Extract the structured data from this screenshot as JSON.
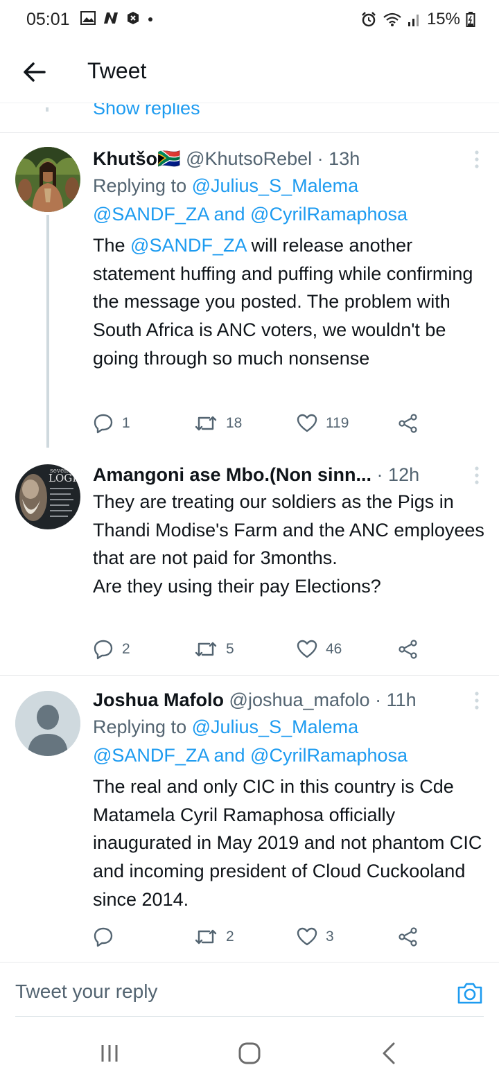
{
  "status_bar": {
    "time": "05:01",
    "battery": "15%",
    "left_icons": [
      "gallery-icon",
      "n-icon",
      "x-badge-icon",
      "dot-icon"
    ],
    "right_icons": [
      "alarm-icon",
      "wifi-icon",
      "signal-icon",
      "battery-icon"
    ]
  },
  "app_bar": {
    "title": "Tweet"
  },
  "show_replies": "Show replies",
  "tweets": [
    {
      "name": "Khutšo",
      "flag": "🇿🇦",
      "handle": "@KhutsoRebel",
      "sep": "·",
      "time": "13h",
      "replying_prefix": "Replying to",
      "replying_1": "@Julius_S_Malema",
      "replying_2": "@SANDF_ZA",
      "replying_and": "and",
      "replying_3": "@CyrilRamaphosa",
      "body_prefix": "The ",
      "body_mention": "@SANDF_ZA",
      "body_rest": " will release another statement huffing and puffing while confirming the message you posted. The problem with South Africa is ANC voters, we wouldn't be going through so much nonsense",
      "replies": "1",
      "retweets": "18",
      "likes": "119"
    },
    {
      "name": "Amangoni ase Mbo.(Non sinn...",
      "sep": "·",
      "time": "12h",
      "body_line1": "They are treating our soldiers as the Pigs in Thandi Modise's Farm and the ANC employees that are not paid for 3months.",
      "body_line2": "Are they using their pay Elections?",
      "avatar_text_1": "seven",
      "avatar_text_2": "LOGIC",
      "replies": "2",
      "retweets": "5",
      "likes": "46"
    },
    {
      "name": "Joshua Mafolo",
      "handle": "@joshua_mafolo",
      "sep": "·",
      "time": "11h",
      "replying_prefix": "Replying to",
      "replying_1": "@Julius_S_Malema",
      "replying_2": "@SANDF_ZA",
      "replying_and": "and",
      "replying_3": "@CyrilRamaphosa",
      "body": "The real and only CIC in this country is Cde Matamela Cyril Ramaphosa officially inaugurated in May 2019 and not phantom CIC and incoming president of Cloud Cuckooland since 2014.",
      "replies": "",
      "retweets": "2",
      "likes": "3"
    }
  ],
  "reply_bar": {
    "placeholder": "Tweet your reply"
  },
  "colors": {
    "accent": "#1d9bf0",
    "text": "#0f1419",
    "secondary": "#536471",
    "divider": "#e7e9eb"
  }
}
